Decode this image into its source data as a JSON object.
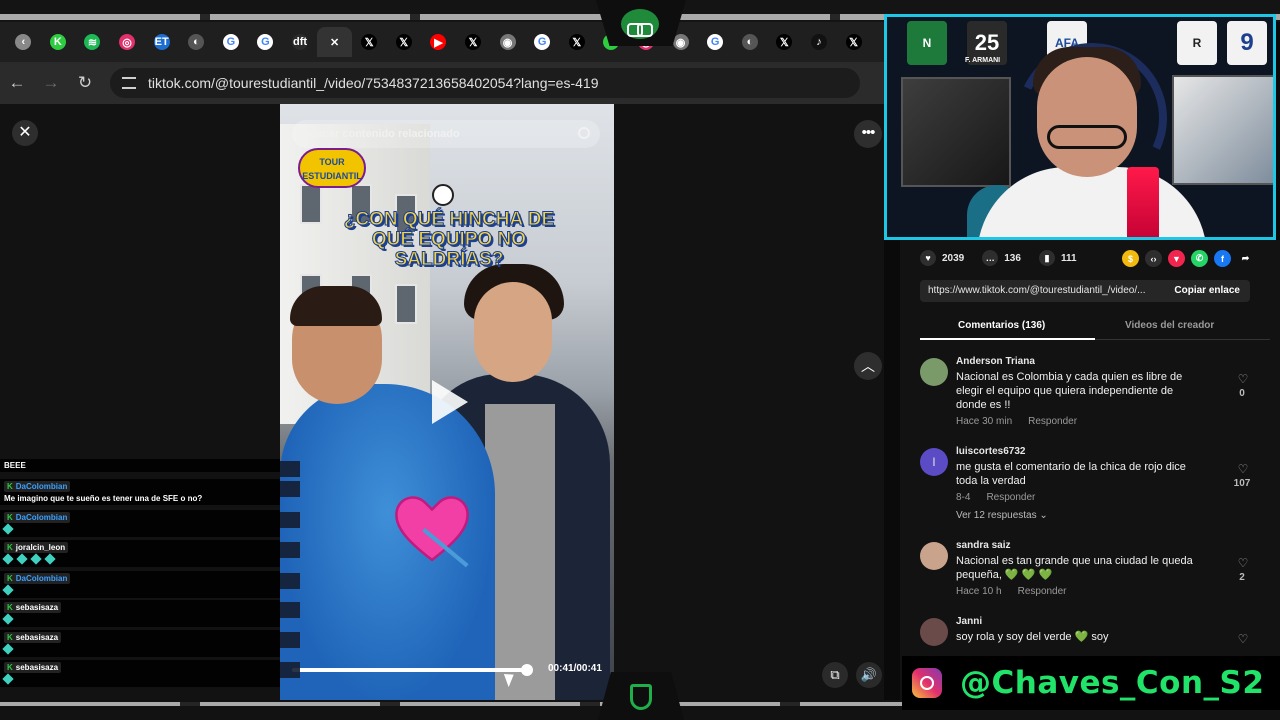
{
  "browser": {
    "url": "tiktok.com/@tourestudiantil_/video/7534837213658402054?lang=es-419",
    "tabs": [
      {
        "icon": "chevron-icon",
        "color": "#888888",
        "glyph": "‹"
      },
      {
        "icon": "kick-icon",
        "color": "#2ecc40",
        "glyph": "K"
      },
      {
        "icon": "spotify-icon",
        "color": "#1db954",
        "glyph": "≋"
      },
      {
        "icon": "instagram-icon",
        "color": "#e1306c",
        "glyph": "◎"
      },
      {
        "icon": "et-icon",
        "color": "#1c6fd1",
        "glyph": "ET"
      },
      {
        "icon": "globe-icon",
        "color": "#555555",
        "glyph": "◐"
      },
      {
        "icon": "google-icon",
        "color": "#ffffff",
        "glyph": "G"
      },
      {
        "icon": "google-icon",
        "color": "#ffffff",
        "glyph": "G"
      },
      {
        "icon": "dft-icon",
        "color": "#2b2b2b",
        "glyph": "dft"
      },
      {
        "icon": "close-icon",
        "color": "#333333",
        "glyph": "✕",
        "active": true
      },
      {
        "icon": "x-icon",
        "color": "#000000",
        "glyph": "𝕏"
      },
      {
        "icon": "x-icon",
        "color": "#000000",
        "glyph": "𝕏"
      },
      {
        "icon": "youtube-icon",
        "color": "#ff0000",
        "glyph": "▶"
      },
      {
        "icon": "x-icon",
        "color": "#000000",
        "glyph": "𝕏"
      },
      {
        "icon": "chrome-icon",
        "color": "#777777",
        "glyph": "◉"
      },
      {
        "icon": "google-icon",
        "color": "#ffffff",
        "glyph": "G"
      },
      {
        "icon": "x-icon",
        "color": "#000000",
        "glyph": "𝕏"
      },
      {
        "icon": "loading-icon",
        "color": "#2ecc40",
        "glyph": "◌"
      },
      {
        "icon": "instagram-icon",
        "color": "#e1306c",
        "glyph": "◎"
      },
      {
        "icon": "chrome-icon",
        "color": "#777777",
        "glyph": "◉"
      },
      {
        "icon": "google-icon",
        "color": "#ffffff",
        "glyph": "G"
      },
      {
        "icon": "globe-icon",
        "color": "#555555",
        "glyph": "◐"
      },
      {
        "icon": "x-icon",
        "color": "#000000",
        "glyph": "𝕏"
      },
      {
        "icon": "tiktok-icon",
        "color": "#111111",
        "glyph": "♪"
      },
      {
        "icon": "x-icon",
        "color": "#000000",
        "glyph": "𝕏"
      }
    ]
  },
  "video": {
    "search_placeholder": "Buscar contenido relacionado",
    "badge_text": "TOUR ESTUDIANTIL",
    "question": "¿CON QUÉ HINCHA DE QUÉ EQUIPO NO SALDRÍAS?",
    "time": "00:41/00:41",
    "progress": 0.98
  },
  "chat": {
    "messages": [
      {
        "user": "",
        "text": "BEEE"
      },
      {
        "user": "DaColombian",
        "text": "Me imagino que te sueño es tener una de SFE o no?"
      },
      {
        "user": "DaColombian",
        "text": ""
      },
      {
        "user": "joralcin_leon",
        "text": ""
      },
      {
        "user": "DaColombian",
        "text": ""
      },
      {
        "user": "sebasisaza",
        "text": ""
      },
      {
        "user": "sebasisaza",
        "text": ""
      },
      {
        "user": "sebasisaza",
        "text": ""
      }
    ]
  },
  "webcam": {
    "crests": [
      "N",
      "25",
      "AFA",
      "R",
      "9"
    ],
    "jersey_name": "F. ARMANI"
  },
  "panel": {
    "likes": "2039",
    "comments_count": "136",
    "saves": "111",
    "link": "https://www.tiktok.com/@tourestudiantil_/video/...",
    "copy_label": "Copiar enlace",
    "tab_comments": "Comentarios (136)",
    "tab_creator": "Videos del creador",
    "reply_label": "Responder",
    "comments": [
      {
        "name": "Anderson Triana",
        "text": "Nacional es Colombia y cada quien es libre de elegir el equipo que quiera independiente de donde es !!",
        "time": "Hace 30 min",
        "likes": "0",
        "avatar": "#7a9a6a"
      },
      {
        "name": "luiscortes6732",
        "text": "me gusta el comentario de la chica de rojo dice toda la verdad",
        "time": "8-4",
        "likes": "107",
        "avatar": "#5b4bc4",
        "initial": "l",
        "replies": "Ver 12 respuestas"
      },
      {
        "name": "sandra saiz",
        "text": "Nacional es tan grande que una ciudad le queda pequeña, 💚 💚 💚",
        "time": "Hace 10 h",
        "likes": "2",
        "avatar": "#c9a38c"
      },
      {
        "name": "Janni",
        "text": "soy rola y soy del verde 💚 soy",
        "time": "",
        "likes": "",
        "avatar": "#6b4a4a"
      }
    ]
  },
  "handle": "@Chaves_Con_S2"
}
